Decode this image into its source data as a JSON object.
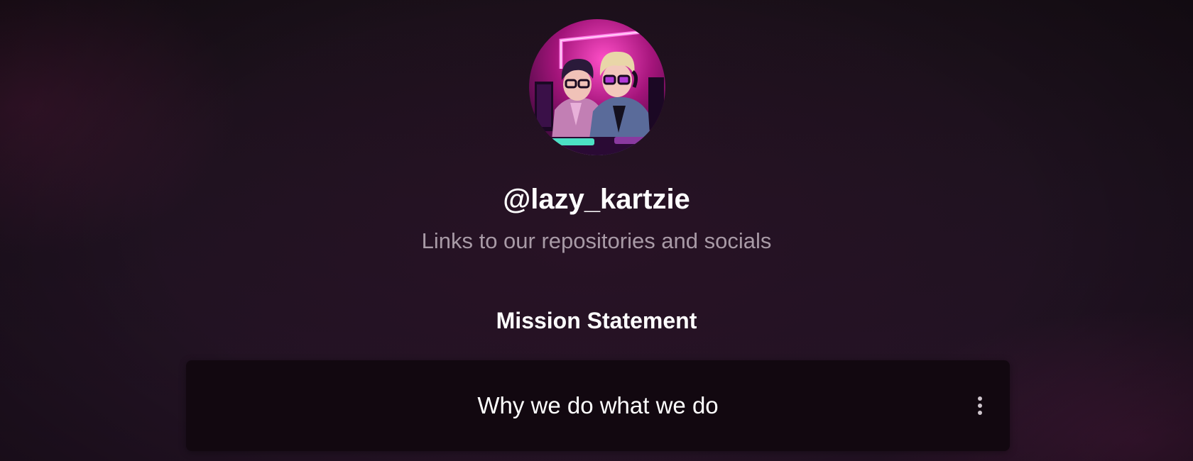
{
  "profile": {
    "avatar_alt": "illustration of two developers with glasses at computers under pink neon light",
    "username": "@lazy_kartzie",
    "bio": "Links to our repositories and socials"
  },
  "sections": [
    {
      "heading": "Mission Statement",
      "links": [
        {
          "label": "Why we do what we do",
          "menu_icon": "more-vertical-icon"
        }
      ]
    }
  ],
  "colors": {
    "background": "#1f1220",
    "card": "#120810",
    "bio_text": "#a89aa6",
    "neon_accent": "#ff3fd2"
  }
}
